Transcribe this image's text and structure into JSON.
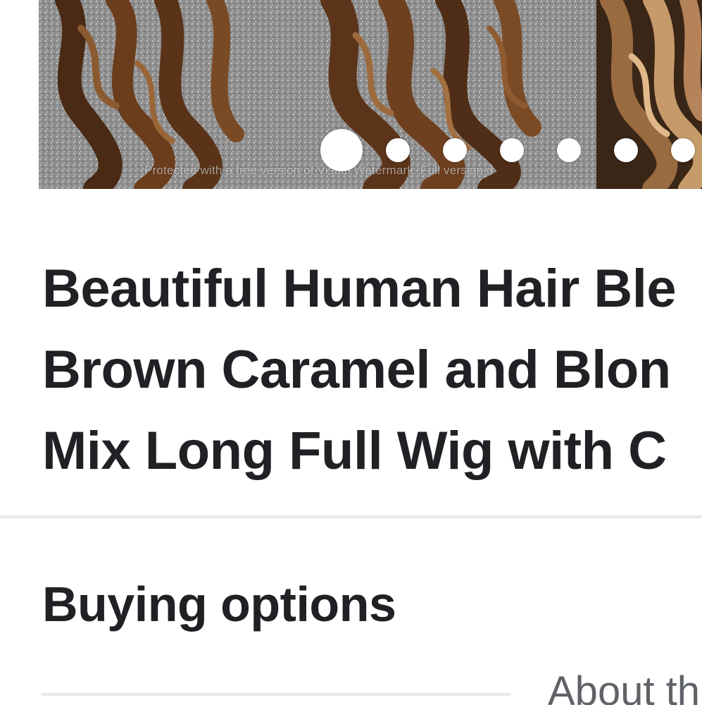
{
  "carousel": {
    "watermark": "Protected with a free version of Visual Watermark. Full version d",
    "slide_count": 7,
    "active_slide": 1
  },
  "product": {
    "title_lines": [
      "Beautiful Human Hair Ble",
      "Brown Caramel and Blon",
      "Mix Long Full Wig with C"
    ]
  },
  "buying_options": {
    "heading": "Buying options"
  },
  "tabs": {
    "about_label": "About th"
  },
  "colors": {
    "text": "#202124",
    "secondary_text": "#5f6368",
    "divider": "#e8e9ee",
    "dot": "#ffffff"
  }
}
